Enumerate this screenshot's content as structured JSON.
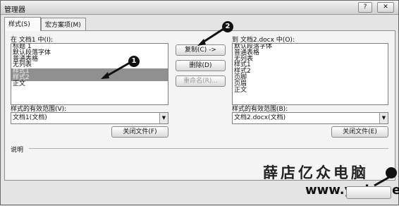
{
  "window": {
    "title": "管理器",
    "help_label": "?",
    "close_label": "✕"
  },
  "tabs": [
    {
      "label": "样式(S)"
    },
    {
      "label": "宏方案项(M)"
    }
  ],
  "left": {
    "label": "在 文档1 中(I):",
    "items": [
      "标题 1",
      "默认段落字体",
      "普通表格",
      "无列表",
      "样式1",
      "样式2",
      "正文"
    ],
    "scope_label": "样式的有效范围(V):",
    "scope_value": "文档1(文档)",
    "close_file": "关闭文件(F)"
  },
  "right": {
    "label": "到 文档2.docx 中(O):",
    "items": [
      "默认段落字体",
      "普通表格",
      "无列表",
      "样式1",
      "样式2",
      "页脚",
      "页眉",
      "正文"
    ],
    "scope_label": "样式的有效范围(B):",
    "scope_value": "文档2.docx(文档)",
    "close_file": "关闭文件(E)"
  },
  "actions": {
    "copy": "复制(C) ->",
    "delete": "删除(D)",
    "rename": "重命名(R)..."
  },
  "description_label": "说明",
  "annotations": [
    "1",
    "2"
  ],
  "watermark": {
    "text": "薛店亿众电脑",
    "url": "www.yzdn.net"
  },
  "colors": {
    "selection": "#909090",
    "dialog_bg": "#e4e4e4"
  }
}
